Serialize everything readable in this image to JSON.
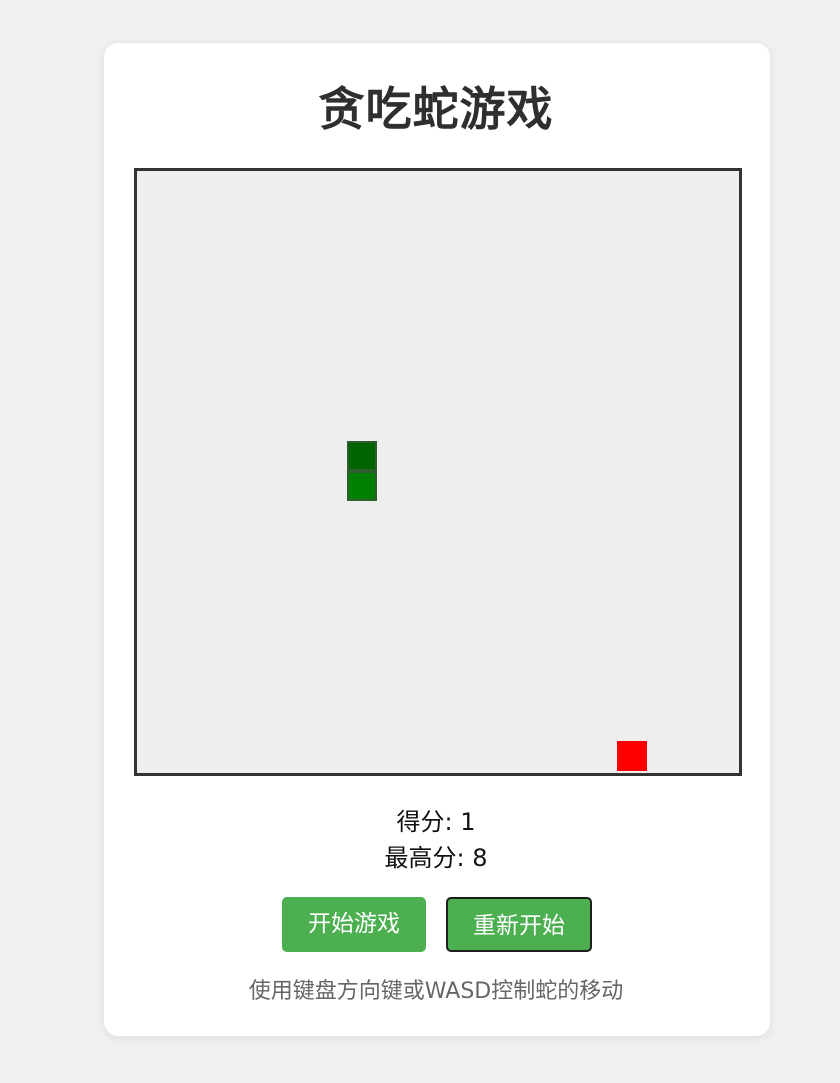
{
  "game": {
    "title": "贪吃蛇游戏",
    "score_label": "得分: 1",
    "high_score_label": "最高分: 8",
    "start_button": "开始游戏",
    "restart_button": "重新开始",
    "instructions": "使用键盘方向键或WASD控制蛇的移动"
  },
  "colors": {
    "background": "#f0f0f0",
    "board": "#eeeeee",
    "snake_head": "#006400",
    "snake_body": "#008000",
    "food": "#ff0000",
    "button": "#4caf50"
  }
}
